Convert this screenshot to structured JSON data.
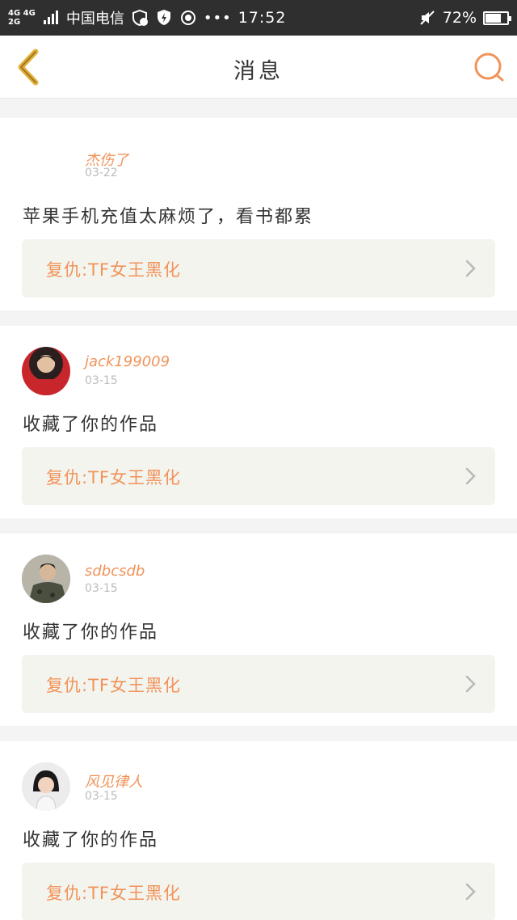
{
  "status_bar": {
    "net_top": "4G 4G",
    "net_bottom": "2G",
    "carrier": "中国电信",
    "dots": "•••",
    "time": "17:52",
    "battery_text": "72%",
    "battery_level": 0.72,
    "icons": [
      "signal-icon",
      "shield-notify-icon",
      "shield-icon",
      "target-icon",
      "mute-icon",
      "battery-icon"
    ]
  },
  "nav": {
    "back_icon": "chevron-left-icon",
    "title": "消息",
    "search_icon": "search-icon",
    "accent_color": "#f0935a"
  },
  "messages": [
    {
      "username": "杰伤了",
      "date": "03-22",
      "avatar": "none",
      "content": "苹果手机充值太麻烦了，看书都累",
      "reply": "复仇:TF女王黑化"
    },
    {
      "username": "jack199009",
      "date": "03-15",
      "avatar": "photo",
      "content": "收藏了你的作品",
      "reply": "复仇:TF女王黑化"
    },
    {
      "username": "sdbcsdb",
      "date": "03-15",
      "avatar": "photo",
      "content": "收藏了你的作品",
      "reply": "复仇:TF女王黑化"
    },
    {
      "username": "风见律人",
      "date": "03-15",
      "avatar": "photo",
      "content": "收藏了你的作品",
      "reply": "复仇:TF女王黑化"
    }
  ]
}
